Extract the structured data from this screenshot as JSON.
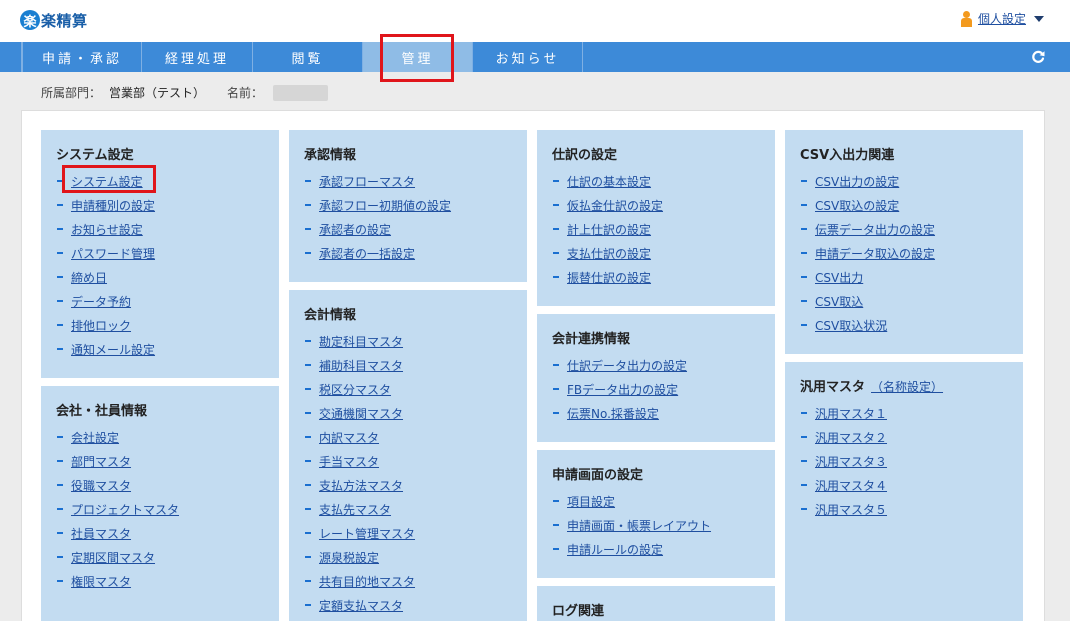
{
  "header": {
    "logo_mark": "楽",
    "logo_text": "楽精算",
    "personal_settings": "個人設定"
  },
  "nav": {
    "items": [
      "申請・承認",
      "経理処理",
      "閲覧",
      "管理",
      "お知らせ"
    ],
    "active": "管理"
  },
  "info": {
    "dept_label": "所属部門：",
    "dept_value": "営業部（テスト）",
    "name_label": "名前："
  },
  "sections": {
    "system": {
      "title": "システム設定",
      "items": [
        "システム設定",
        "申請種別の設定",
        "お知らせ設定",
        "パスワード管理",
        "締め日",
        "データ予約",
        "排他ロック",
        "通知メール設定"
      ]
    },
    "company": {
      "title": "会社・社員情報",
      "items": [
        "会社設定",
        "部門マスタ",
        "役職マスタ",
        "プロジェクトマスタ",
        "社員マスタ",
        "定期区間マスタ",
        "権限マスタ"
      ]
    },
    "approval": {
      "title": "承認情報",
      "items": [
        "承認フローマスタ",
        "承認フロー初期値の設定",
        "承認者の設定",
        "承認者の一括設定"
      ]
    },
    "accounting": {
      "title": "会計情報",
      "items": [
        "勘定科目マスタ",
        "補助科目マスタ",
        "税区分マスタ",
        "交通機関マスタ",
        "内訳マスタ",
        "手当マスタ",
        "支払方法マスタ",
        "支払先マスタ",
        "レート管理マスタ",
        "源泉税設定",
        "共有目的地マスタ",
        "定額支払マスタ"
      ]
    },
    "journal": {
      "title": "仕訳の設定",
      "items": [
        "仕訳の基本設定",
        "仮払金仕訳の設定",
        "計上仕訳の設定",
        "支払仕訳の設定",
        "振替仕訳の設定"
      ]
    },
    "link": {
      "title": "会計連携情報",
      "items": [
        "仕訳データ出力の設定",
        "FBデータ出力の設定",
        "伝票No.採番設定"
      ]
    },
    "screen": {
      "title": "申請画面の設定",
      "items": [
        "項目設定",
        "申請画面・帳票レイアウト",
        "申請ルールの設定"
      ]
    },
    "log": {
      "title": "ログ関連",
      "items": []
    },
    "csv": {
      "title": "CSV入出力関連",
      "items": [
        "CSV出力の設定",
        "CSV取込の設定",
        "伝票データ出力の設定",
        "申請データ取込の設定",
        "CSV出力",
        "CSV取込",
        "CSV取込状況"
      ]
    },
    "generic": {
      "title": "汎用マスタ",
      "title_link": "（名称設定）",
      "items": [
        "汎用マスタ１",
        "汎用マスタ２",
        "汎用マスタ３",
        "汎用マスタ４",
        "汎用マスタ５"
      ]
    }
  },
  "colors": {
    "nav_bg": "#3d8ad8",
    "nav_active": "#8fbce6",
    "box_bg": "#c3dcf1",
    "link": "#1f4fa0",
    "highlight": "#e0151b"
  }
}
